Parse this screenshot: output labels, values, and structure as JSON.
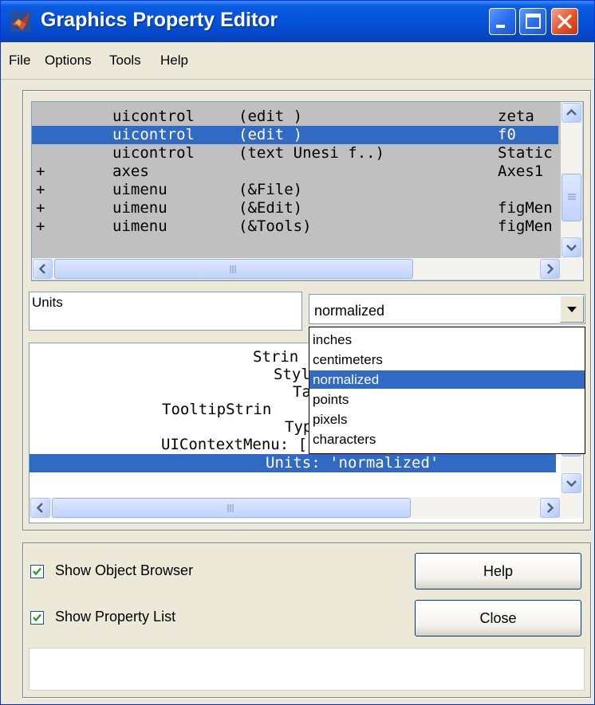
{
  "window": {
    "title": "Graphics Property Editor",
    "accent": "#0552d8",
    "selection_color": "#316ac5"
  },
  "menu": [
    "File",
    "Options",
    "Tools",
    "Help"
  ],
  "object_browser": {
    "rows": [
      {
        "expander": "",
        "type": "uicontrol",
        "detail": "(edit )",
        "tag": "zeta",
        "selected": false
      },
      {
        "expander": "",
        "type": "uicontrol",
        "detail": "(edit )",
        "tag": "f0",
        "selected": true
      },
      {
        "expander": "",
        "type": "uicontrol",
        "detail": "(text Unesi f..)",
        "tag": "Static",
        "selected": false
      },
      {
        "expander": "+",
        "type": "axes",
        "detail": "",
        "tag": "Axes1",
        "selected": false
      },
      {
        "expander": "+",
        "type": "uimenu",
        "detail": "(&File)",
        "tag": "",
        "selected": false
      },
      {
        "expander": "+",
        "type": "uimenu",
        "detail": "(&Edit)",
        "tag": "figMen",
        "selected": false
      },
      {
        "expander": "+",
        "type": "uimenu",
        "detail": "(&Tools)",
        "tag": "figMen",
        "selected": false
      }
    ]
  },
  "property_name": "Units",
  "property_value": "normalized",
  "dropdown_options": [
    {
      "label": "inches",
      "selected": false
    },
    {
      "label": "centimeters",
      "selected": false
    },
    {
      "label": "normalized",
      "selected": true
    },
    {
      "label": "points",
      "selected": false
    },
    {
      "label": "pixels",
      "selected": false
    },
    {
      "label": "characters",
      "selected": false
    }
  ],
  "property_list": {
    "rows": [
      {
        "text": "Strin",
        "selected": false
      },
      {
        "text": "Styl",
        "selected": false
      },
      {
        "text": "Ta",
        "selected": false
      },
      {
        "text": "TooltipStrin",
        "selected": false
      },
      {
        "text": "Typ",
        "selected": false
      },
      {
        "text": "UIContextMenu: []",
        "selected": false
      },
      {
        "text": "Units: 'normalized'",
        "selected": true
      }
    ]
  },
  "options": {
    "show_object_browser": {
      "label": "Show Object Browser",
      "checked": true
    },
    "show_property_list": {
      "label": "Show Property List",
      "checked": true
    }
  },
  "buttons": {
    "help": "Help",
    "close": "Close"
  },
  "icons": {
    "app": "matlab-logo-icon",
    "minimize": "minimize-icon",
    "maximize": "maximize-icon",
    "close": "close-icon",
    "check": "check-icon",
    "scroll_up": "scroll-up-icon",
    "scroll_down": "scroll-down-icon",
    "scroll_left": "scroll-left-icon",
    "scroll_right": "scroll-right-icon",
    "dropdown": "chevron-down-icon"
  }
}
